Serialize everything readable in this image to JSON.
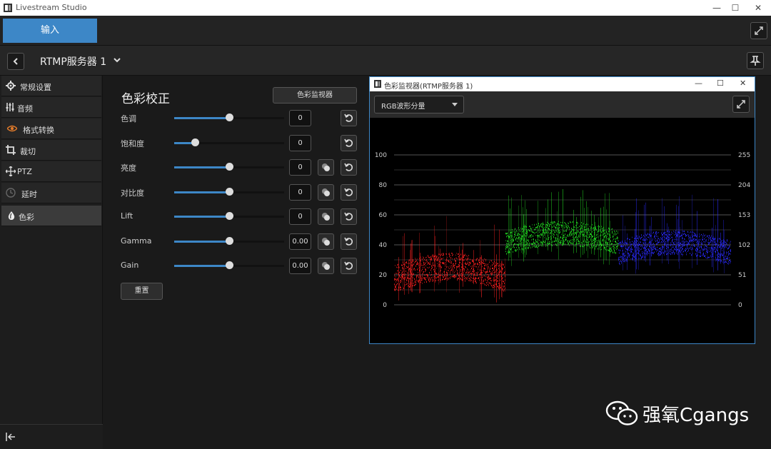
{
  "window": {
    "title": "Livestream Studio",
    "minimize": "—",
    "maximize": "☐",
    "close": "✕"
  },
  "toprow": {
    "input_tab": "输入"
  },
  "source": {
    "name": "RTMP服务器 1"
  },
  "sidebar": {
    "items": [
      {
        "label": "常规设置",
        "icon": "gear-icon"
      },
      {
        "label": "音频",
        "icon": "audio-mixer-icon"
      },
      {
        "label": "格式转换",
        "icon": "eye-icon"
      },
      {
        "label": "裁切",
        "icon": "crop-icon"
      },
      {
        "label": "PTZ",
        "icon": "ptz-move-icon"
      },
      {
        "label": "延时",
        "icon": "clock-icon"
      },
      {
        "label": "色彩",
        "icon": "droplet-icon",
        "active": true
      }
    ]
  },
  "color_panel": {
    "title": "色彩校正",
    "monitor_button": "色彩监视器",
    "reset_all": "重置",
    "rows": [
      {
        "label": "色调",
        "value": "0",
        "level": 0.5,
        "picker": false
      },
      {
        "label": "饱和度",
        "value": "0",
        "level": 0.19,
        "picker": false
      },
      {
        "label": "亮度",
        "value": "0",
        "level": 0.5,
        "picker": true
      },
      {
        "label": "对比度",
        "value": "0",
        "level": 0.5,
        "picker": true
      },
      {
        "label": "Lift",
        "value": "0",
        "level": 0.5,
        "picker": true
      },
      {
        "label": "Gamma",
        "value": "0.00",
        "level": 0.5,
        "picker": true
      },
      {
        "label": "Gain",
        "value": "0.00",
        "level": 0.5,
        "picker": true
      }
    ]
  },
  "monitor_window": {
    "title": "色彩监视器(RTMP服务器 1)",
    "mode": "RGB波形分量",
    "scale_left": [
      "100",
      "80",
      "60",
      "40",
      "20",
      "0"
    ],
    "scale_right": [
      "255",
      "204",
      "153",
      "102",
      "51",
      "0"
    ]
  },
  "watermark": {
    "text": "强氧Cgangs"
  },
  "colors": {
    "accent": "#3d87c7",
    "red": "#ff2020",
    "green": "#22dd22",
    "blue": "#2a2aff"
  }
}
